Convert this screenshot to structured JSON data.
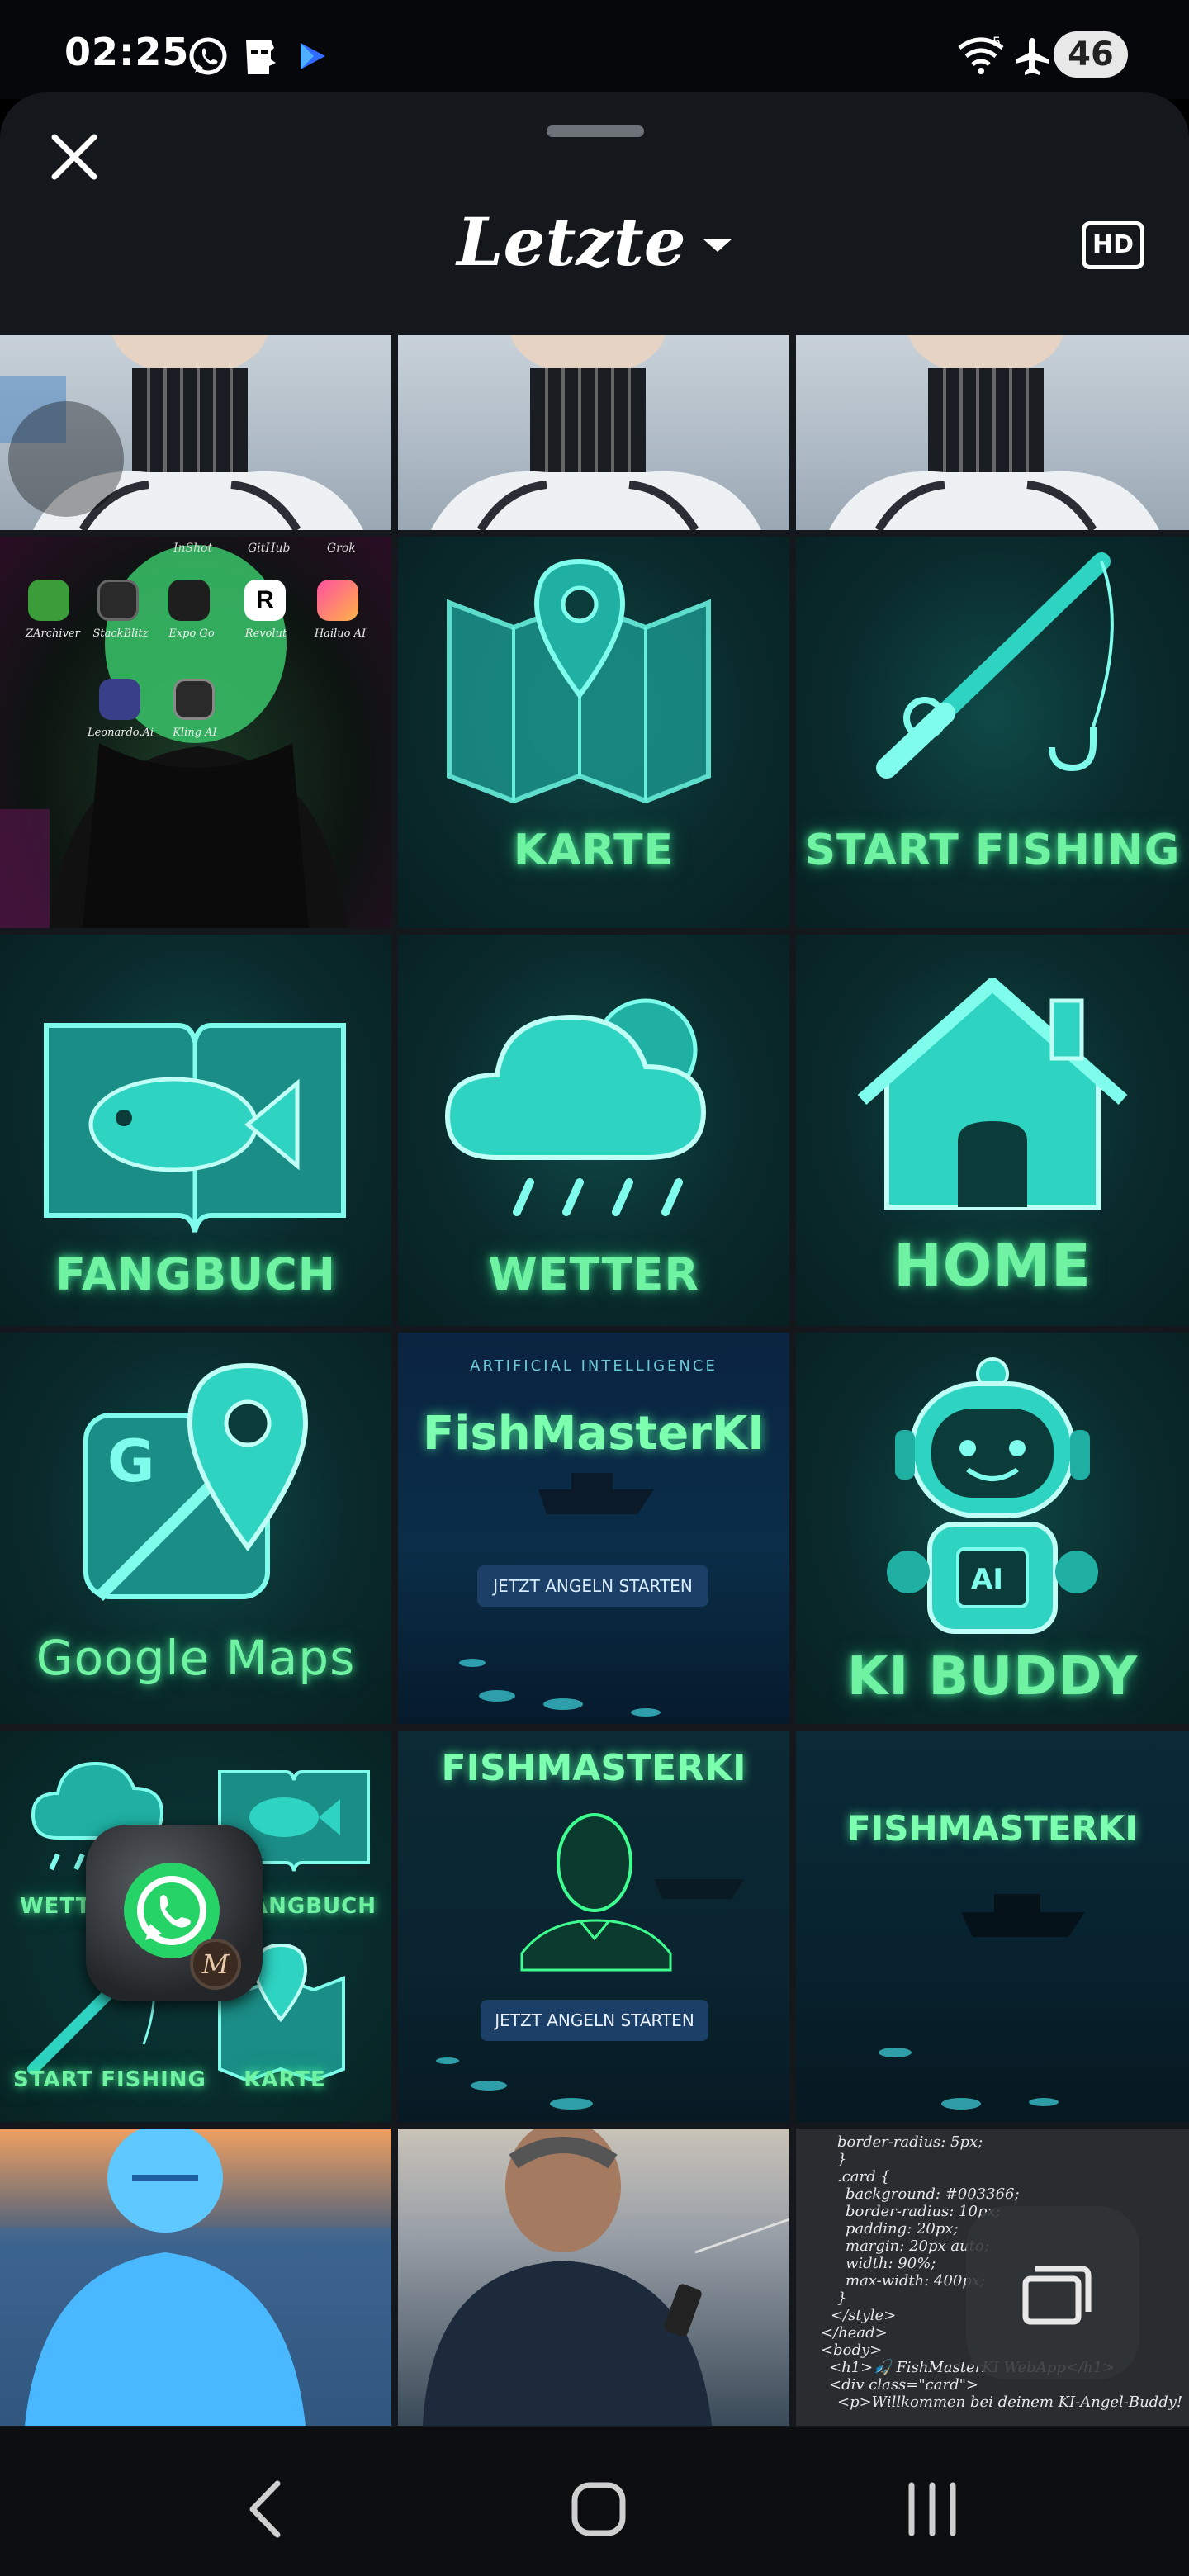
{
  "status_bar": {
    "time": "02:25",
    "network_label": "5",
    "battery": "46"
  },
  "header": {
    "title": "Letzte",
    "hd_label": "HD"
  },
  "gallery": {
    "tile_labels": {
      "karte": "KARTE",
      "start_fishing": "START FISHING",
      "fangbuch": "FANGBUCH",
      "wetter": "WETTER",
      "home": "HOME",
      "google_maps": "Google Maps",
      "ki_buddy": "KI BUDDY"
    },
    "poster1": {
      "eyebrow": "ARTIFICIAL INTELLIGENCE",
      "title": "FishMasterKI",
      "button": "JETZT ANGELN STARTEN"
    },
    "poster2": {
      "title": "FISHMASTERKI",
      "button": "JETZT ANGELN STARTEN"
    },
    "poster3": {
      "title": "FISHMASTERKI"
    },
    "collage": {
      "wetter": "WETTER",
      "fangbuch": "FANGBUCH",
      "start_fishing": "START FISHING",
      "karte": "KARTE"
    },
    "homescreen_apps": [
      {
        "label": "InShot"
      },
      {
        "label": "GitHub"
      },
      {
        "label": "Grok"
      },
      {
        "label": "ZArchiver"
      },
      {
        "label": "StackBlitz"
      },
      {
        "label": "Expo Go"
      },
      {
        "label": "Revolut"
      },
      {
        "label": "Hailuo AI"
      },
      {
        "label": "Leonardo.Ai"
      },
      {
        "label": "Kling AI"
      }
    ],
    "code_lines": [
      "border-radius: 5px;",
      "}",
      ".card {",
      "background: #003366;",
      "border-radius: 10px;",
      "padding: 20px;",
      "margin: 20px auto;",
      "width: 90%;",
      "max-width: 400px;",
      "}",
      "</style>",
      "</head>",
      "<body>",
      "<h1>🎣 FishMasterKI WebApp</h1>",
      "<div class=\"card\">",
      "<p>Willkommen bei deinem KI-Angel-Buddy!"
    ]
  },
  "floating": {
    "chat_head_badge": "M"
  }
}
